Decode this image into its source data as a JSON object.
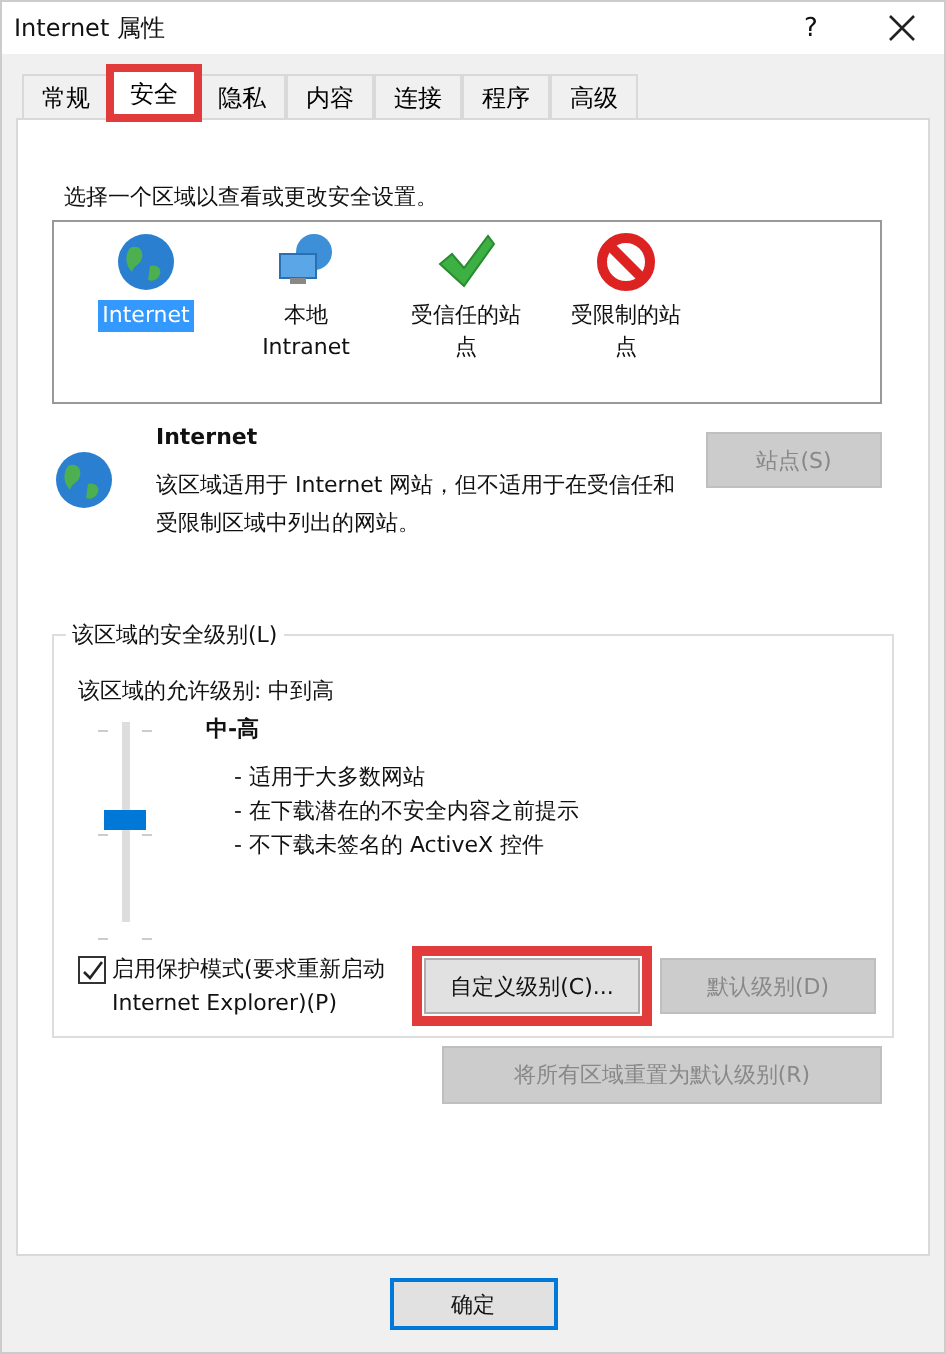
{
  "window": {
    "title": "Internet 属性",
    "help": "?"
  },
  "tabs": [
    {
      "label": "常规",
      "selected": false,
      "highlighted": false
    },
    {
      "label": "安全",
      "selected": true,
      "highlighted": true
    },
    {
      "label": "隐私",
      "selected": false,
      "highlighted": false
    },
    {
      "label": "内容",
      "selected": false,
      "highlighted": false
    },
    {
      "label": "连接",
      "selected": false,
      "highlighted": false
    },
    {
      "label": "程序",
      "selected": false,
      "highlighted": false
    },
    {
      "label": "高级",
      "selected": false,
      "highlighted": false
    }
  ],
  "zones": {
    "prompt": "选择一个区域以查看或更改安全设置。",
    "items": [
      {
        "label": "Internet",
        "kind": "globe",
        "selected": true
      },
      {
        "label": "本地 Intranet",
        "kind": "intranet",
        "selected": false
      },
      {
        "label": "受信任的站点",
        "kind": "trusted",
        "selected": false
      },
      {
        "label": "受限制的站点",
        "kind": "restricted",
        "selected": false
      }
    ]
  },
  "zone_info": {
    "kind": "globe",
    "title": "Internet",
    "description": "该区域适用于 Internet 网站，但不适用于在受信任和受限制区域中列出的网站。",
    "sites_button": {
      "label": "站点(S)",
      "disabled": true
    }
  },
  "security_level": {
    "legend": "该区域的安全级别(L)",
    "allowed": "该区域的允许级别: 中到高",
    "level": 0.5,
    "level_name": "中-高",
    "bullets": [
      "- 适用于大多数网站",
      "- 在下载潜在的不安全内容之前提示",
      "- 不下载未签名的 ActiveX 控件"
    ],
    "protected_mode": {
      "label": "启用保护模式(要求重新启动 Internet Explorer)(P)",
      "checked": true
    },
    "buttons": [
      {
        "label": "自定义级别(C)...",
        "disabled": false,
        "highlighted": true
      },
      {
        "label": "默认级别(D)",
        "disabled": true,
        "highlighted": false
      }
    ],
    "reset_button": {
      "label": "将所有区域重置为默认级别(R)",
      "disabled": true
    }
  },
  "footer": {
    "ok_button": {
      "label": "确定",
      "default": true
    }
  }
}
